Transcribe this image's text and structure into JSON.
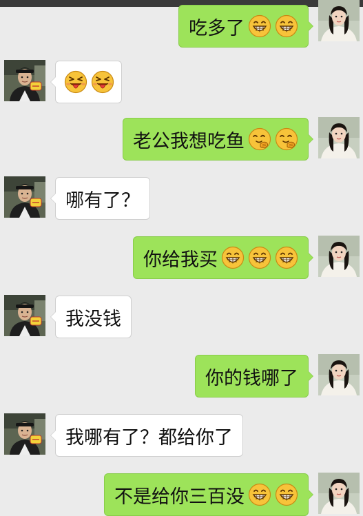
{
  "messages": [
    {
      "side": "right",
      "text": "吃多了",
      "emoji": "grin",
      "emoji_count": 2
    },
    {
      "side": "left",
      "text": "",
      "emoji": "tongue-wink",
      "emoji_count": 2
    },
    {
      "side": "right",
      "text": "老公我想吃鱼",
      "emoji": "giggle",
      "emoji_count": 2
    },
    {
      "side": "left",
      "text": "哪有了？",
      "emoji": "",
      "emoji_count": 0
    },
    {
      "side": "right",
      "text": "你给我买",
      "emoji": "grin",
      "emoji_count": 3
    },
    {
      "side": "left",
      "text": "我没钱",
      "emoji": "",
      "emoji_count": 0
    },
    {
      "side": "right",
      "text": "你的钱哪了",
      "emoji": "",
      "emoji_count": 0
    },
    {
      "side": "left",
      "text": "我哪有了？都给你了",
      "emoji": "",
      "emoji_count": 0
    },
    {
      "side": "right",
      "text": "不是给你三百没",
      "emoji": "grin",
      "emoji_count": 2
    }
  ],
  "colors": {
    "background": "#ebebeb",
    "sent_bubble": "#9de35a",
    "received_bubble": "#ffffff",
    "emoji_face": "#f7c33a"
  },
  "avatars": {
    "left": "man-avatar-icon",
    "right": "woman-avatar-icon"
  }
}
